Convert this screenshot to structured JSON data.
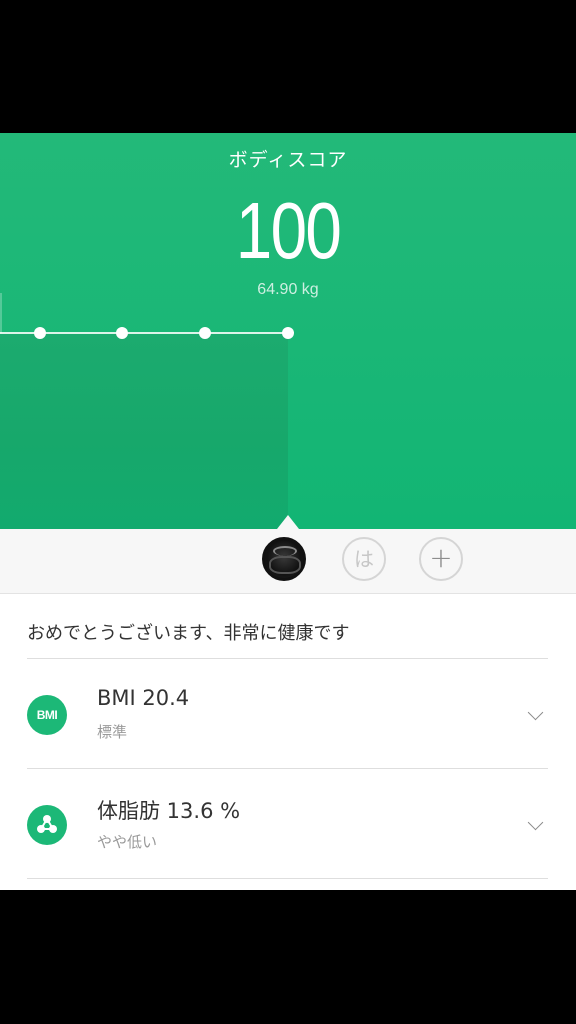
{
  "header": {
    "title": "ボディスコア",
    "score": "100",
    "weight": "64.90 kg"
  },
  "users": {
    "current_user": "profile",
    "user2_initial": "は",
    "add_symbol": "+"
  },
  "message": "おめでとうございます、非常に健康です",
  "metrics": [
    {
      "icon_text": "BMI",
      "icon_name": "bmi-icon",
      "label": "BMI 20.4",
      "status": "標準"
    },
    {
      "icon_name": "body-fat-icon",
      "label": "体脂肪 13.6 %",
      "status": "やや低い"
    }
  ],
  "colors": {
    "accent": "#1cb877",
    "hero_bg": "#1db776",
    "text_primary": "#333333",
    "text_secondary": "#9a9a9a"
  }
}
